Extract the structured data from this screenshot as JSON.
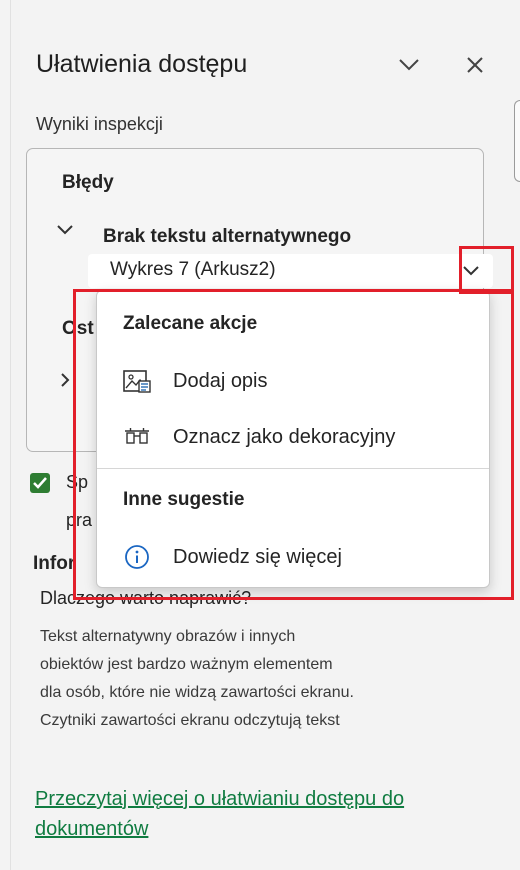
{
  "pane": {
    "title": "Ułatwienia dostępu",
    "subtitle": "Wyniki inspekcji"
  },
  "results": {
    "errors_heading": "Błędy",
    "group_title": "Brak tekstu alternatywnego",
    "item_label": "Wykres 7 (Arkusz2)",
    "warnings_heading_partial": "Ost"
  },
  "menu": {
    "recommended_heading": "Zalecane akcje",
    "add_description": "Dodaj opis",
    "mark_decorative": "Oznacz jako dekoracyjny",
    "other_heading": "Inne sugestie",
    "learn_more": "Dowiedz się więcej"
  },
  "options": {
    "checkbox_text_line1_partial": "Sp",
    "checkbox_text_line2_partial": "pra"
  },
  "info": {
    "heading_partial": "Infor",
    "question": "Dlaczego warto naprawić?",
    "para_lines": [
      "Tekst alternatywny obrazów i innych",
      "obiektów jest bardzo ważnym elementem",
      "dla osób, które nie widzą zawartości ekranu.",
      "Czytniki zawartości ekranu odczytują tekst"
    ]
  },
  "footer": {
    "link_line1": "Przeczytaj więcej o ułatwianiu dostępu do",
    "link_line2": "dokumentów"
  },
  "colors": {
    "highlight": "#e21f2a",
    "checkbox": "#2e7d32",
    "link": "#107c41"
  }
}
